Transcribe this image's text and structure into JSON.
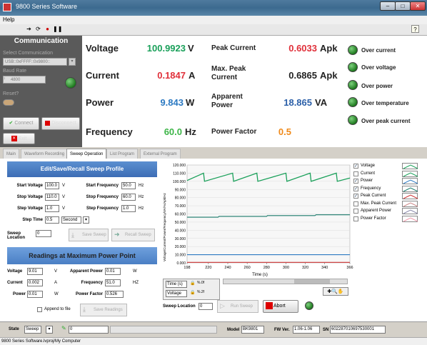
{
  "window": {
    "title": "9800 Series Software"
  },
  "menu": {
    "help": "Help"
  },
  "comm": {
    "title": "Communication",
    "select_label": "Select Communication",
    "select_value": "USB::0xFFFF::0x9800::",
    "baud_label": "Baud Rate",
    "baud_value": "4800",
    "reset_label": "Reset?",
    "connect": "Connect",
    "disconnect": "Disconnect",
    "exit": "Exit"
  },
  "measure": {
    "voltage": {
      "label": "Voltage",
      "value": "100.9923",
      "unit": "V"
    },
    "current": {
      "label": "Current",
      "value": "0.1847",
      "unit": "A"
    },
    "power": {
      "label": "Power",
      "value": "9.843",
      "unit": "W"
    },
    "frequency": {
      "label": "Frequency",
      "value": "60.0",
      "unit": "Hz"
    },
    "peak_current": {
      "label": "Peak Current",
      "value": "0.6033",
      "unit": "Apk"
    },
    "max_peak": {
      "label": "Max. Peak Current",
      "value": "0.6865",
      "unit": "Apk"
    },
    "apparent": {
      "label": "Apparent Power",
      "value": "18.865",
      "unit": "VA"
    },
    "pf": {
      "label": "Power Factor",
      "value": "0.5"
    }
  },
  "leds": {
    "over_current": "Over current",
    "over_voltage": "Over voltage",
    "over_power": "Over power",
    "over_temp": "Over temperature",
    "over_peak": "Over peak current"
  },
  "colors": {
    "voltage": "#1aa05a",
    "current": "#e0303a",
    "power": "#2b79c2",
    "frequency": "#3db548",
    "apparent": "#2b5fa8",
    "pf": "#f08a1a"
  },
  "tabs": [
    "Main",
    "Waveform Recording",
    "Sweep Operation",
    "List Program",
    "External Program"
  ],
  "sweep": {
    "header": "Edit/Save/Recall Sweep Profile",
    "start_voltage_label": "Start Voltage",
    "start_voltage": "100.0",
    "v": "V",
    "stop_voltage_label": "Stop Voltage",
    "stop_voltage": "110.0",
    "step_voltage_label": "Step Voltage",
    "step_voltage": "1.0",
    "start_freq_label": "Start Frequency",
    "start_freq": "50.0",
    "hz": "Hz",
    "stop_freq_label": "Stop Frequency",
    "stop_freq": "60.0",
    "step_freq_label": "Step Frequency",
    "step_freq": "1.0",
    "step_time_label": "Step Time",
    "step_time": "0.5",
    "step_time_unit": "Second",
    "location_label": "Sweep Location",
    "location": "0",
    "save": "Save Sweep",
    "recall": "Recall Sweep"
  },
  "readings": {
    "header": "Readings at Maximum Power Point",
    "voltage_label": "Voltage",
    "voltage": "9.01",
    "voltage_unit": "V",
    "current_label": "Current",
    "current": "0.002",
    "current_unit": "A",
    "power_label": "Power",
    "power": "0.01",
    "power_unit": "W",
    "apparent_label": "Apparent Power",
    "apparent": "0.01",
    "apparent_unit": "W",
    "freq_label": "Frequency",
    "freq": "51.0",
    "freq_unit": "HZ",
    "pf_label": "Power Factor",
    "pf": "0.526",
    "append": "Append to file",
    "save": "Save Readings"
  },
  "run": {
    "location_label": "Sweep Location",
    "location": "0",
    "run": "Run Sweep",
    "abort": "Abort"
  },
  "scale": {
    "time": "Time (s)",
    "voltage": "Voltage",
    "time_fmt": "%.0f",
    "volt_fmt": "%.2f"
  },
  "legend": [
    "Voltage",
    "Current",
    "Power",
    "Frequency",
    "Peak Current",
    "Max. Peak Current",
    "Apparent Power",
    "Power Factor"
  ],
  "legend_checked": [
    true,
    false,
    true,
    true,
    true,
    false,
    false,
    false
  ],
  "legend_colors": [
    "#1aa05a",
    "#1aa05a",
    "#2b79c2",
    "#1a7a6a",
    "#c33",
    "#c88",
    "#88a",
    "#e9a"
  ],
  "chart_data": {
    "type": "line",
    "xlabel": "Time (s)",
    "ylabel": "Voltage/Current/Power/Frequency/VA/%/Apk/Hz",
    "xlim": [
      198,
      366
    ],
    "ylim": [
      0,
      120
    ],
    "xticks": [
      "198",
      "220",
      "240",
      "260",
      "280",
      "300",
      "320",
      "340",
      "366"
    ],
    "yticks": [
      "0.000",
      "10.000",
      "20.000",
      "30.000",
      "40.000",
      "50.000",
      "60.000",
      "70.000",
      "80.000",
      "90.000",
      "100.000",
      "110.000",
      "120.000"
    ],
    "series": [
      {
        "name": "Voltage",
        "color": "#1aa05a",
        "x": [
          198,
          215,
          216,
          245,
          246,
          270,
          271,
          300,
          301,
          325,
          326,
          352,
          353,
          366
        ],
        "y": [
          101,
          110,
          100,
          110,
          100,
          110,
          100,
          110,
          100,
          110,
          100,
          110,
          100,
          104
        ]
      },
      {
        "name": "Frequency",
        "color": "#1a7a6a",
        "x": [
          198,
          230,
          231,
          280,
          281,
          330,
          331,
          366
        ],
        "y": [
          56,
          56,
          57,
          57,
          58,
          58,
          59,
          59
        ]
      },
      {
        "name": "Power",
        "color": "#2b79c2",
        "x": [
          198,
          366
        ],
        "y": [
          10,
          10
        ]
      },
      {
        "name": "Peak Current",
        "color": "#c33",
        "x": [
          198,
          366
        ],
        "y": [
          0.6,
          0.6
        ]
      }
    ]
  },
  "status": {
    "state_label": "State",
    "state": "Sweep",
    "count": "0",
    "model_label": "Model",
    "model": "BK9801",
    "fw_label": "FW Ver.",
    "fw": "1.06-1.06",
    "sn_label": "SN",
    "sn": "602287010697530001"
  },
  "bottom": {
    "path": "9800 Series Software.lvproj/My Computer"
  }
}
